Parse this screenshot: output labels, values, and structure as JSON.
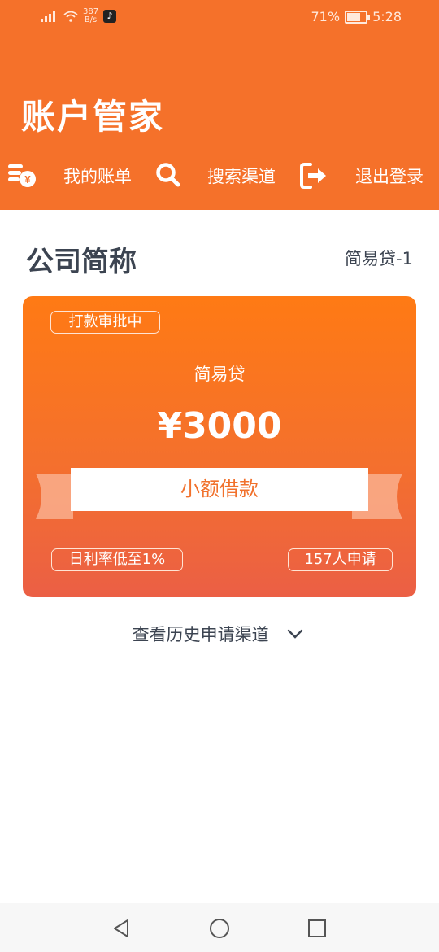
{
  "status_bar": {
    "signal_label": "4G",
    "speed_value": "387",
    "speed_unit": "B/s",
    "app_glyph": "♪",
    "battery_percent": "71%",
    "battery_level": 0.71,
    "time": "5:28"
  },
  "header": {
    "title": "账户管家",
    "nav": [
      {
        "label": "我的账单",
        "icon": "bill-yen-icon"
      },
      {
        "label": "搜索渠道",
        "icon": "search-icon"
      },
      {
        "label": "退出登录",
        "icon": "logout-icon"
      }
    ]
  },
  "section": {
    "company": "公司简称",
    "product_tag": "简易贷-1"
  },
  "card": {
    "status": "打款审批中",
    "product_name": "简易贷",
    "amount": "¥3000",
    "banner": "小额借款",
    "rate": "日利率低至1%",
    "applicants": "157人申请"
  },
  "history": {
    "label": "查看历史申请渠道",
    "icon": "chevron-down-icon"
  },
  "system_nav": {
    "buttons": [
      "back-icon",
      "home-icon",
      "recents-icon"
    ]
  },
  "colors": {
    "brand": "#f5712a",
    "text_dark": "#3c4451",
    "card_top": "#ff7a14",
    "card_bottom": "#eb5f45"
  }
}
